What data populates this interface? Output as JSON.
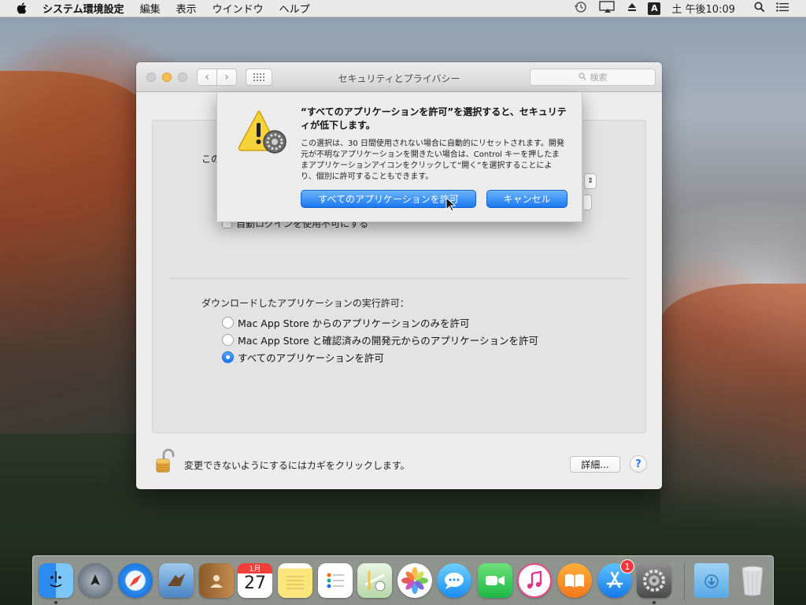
{
  "menubar": {
    "app_name": "システム環境設定",
    "items": [
      "編集",
      "表示",
      "ウインドウ",
      "ヘルプ"
    ],
    "input_source": "A",
    "clock": "土 午後10:09"
  },
  "window": {
    "title": "セキュリティとプライバシー",
    "search_placeholder": "検索",
    "partial_label": "この",
    "autologin_label": "自動ログインを使用不可にする",
    "downloads_label": "ダウンロードしたアプリケーションの実行許可：",
    "radio_options": [
      {
        "label": "Mac App Store からのアプリケーションのみを許可",
        "selected": false
      },
      {
        "label": "Mac App Store と確認済みの開発元からのアプリケーションを許可",
        "selected": false
      },
      {
        "label": "すべてのアプリケーションを許可",
        "selected": true
      }
    ],
    "lock_text": "変更できないようにするにはカギをクリックします。",
    "advanced_label": "詳細...",
    "help_label": "?"
  },
  "alert": {
    "title": "“すべてのアプリケーションを許可”を選択すると、セキュリティが低下します。",
    "message": "この選択は、30 日間使用されない場合に自動的にリセットされます。開発元が不明なアプリケーションを開きたい場合は、Control キーを押したままアプリケーションアイコンをクリックして“開く”を選択することにより、個別に許可することもできます。",
    "confirm_label": "すべてのアプリケーションを許可",
    "cancel_label": "キャンセル"
  },
  "dock": {
    "calendar_month": "1月",
    "calendar_day": "27",
    "appstore_badge": "1"
  }
}
